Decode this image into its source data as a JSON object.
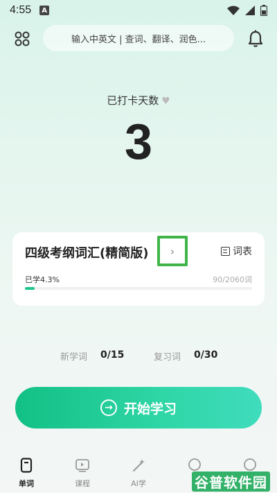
{
  "status_bar": {
    "time": "4:55",
    "indicator": "A"
  },
  "header": {
    "search_placeholder": "输入中英文 | 查词、翻译、润色..."
  },
  "streak": {
    "label": "已打卡天数",
    "days": "3"
  },
  "book": {
    "title": "四级考纲词汇(精简版)",
    "switch_glyph": "›",
    "wordlist_label": "词表",
    "learned_label": "已学4.3%",
    "progress_text": "90/2060词",
    "progress_fraction": 0.043
  },
  "stats": {
    "new_label": "新学词",
    "new_value": "0/15",
    "review_label": "复习词",
    "review_value": "0/30"
  },
  "start_button": {
    "label": "开始学习",
    "icon_glyph": "→"
  },
  "nav": {
    "items": [
      {
        "label": "单词",
        "icon": "word-card-icon",
        "active": true
      },
      {
        "label": "课程",
        "icon": "course-play-icon",
        "active": false
      },
      {
        "label": "AI学",
        "icon": "ai-wand-icon",
        "active": false
      },
      {
        "label": "",
        "icon": "chat-icon",
        "active": false
      },
      {
        "label": "",
        "icon": "profile-icon",
        "active": false
      }
    ]
  },
  "watermark": "谷普软件园",
  "colors": {
    "accent": "#1bc48c",
    "highlight_box": "#3fb548"
  }
}
